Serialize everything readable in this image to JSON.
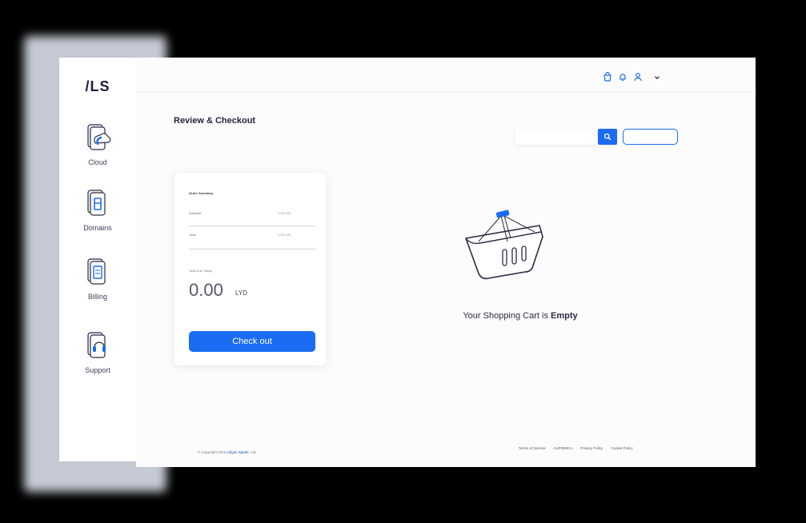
{
  "app": {
    "logo": "/LS"
  },
  "sidebar": {
    "items": [
      {
        "label": "Cloud",
        "icon": "cloud-icon"
      },
      {
        "label": "Domains",
        "icon": "domains-icon"
      },
      {
        "label": "Billing",
        "icon": "billing-icon"
      },
      {
        "label": "Support",
        "icon": "support-icon"
      }
    ]
  },
  "header": {
    "icons": [
      "cart-icon",
      "bell-icon",
      "user-icon",
      "chevron-down-icon"
    ]
  },
  "page": {
    "title": "Review & Checkout"
  },
  "search": {
    "placeholder": "",
    "button_icon": "search-icon"
  },
  "order": {
    "summary_title": "Order Summary",
    "rows": [
      {
        "label": "Subtotal",
        "value": "0.00 LYD"
      },
      {
        "label": "Total",
        "value": "0.00 LYD"
      }
    ],
    "total_due_label": "Total Due Today",
    "amount": "0.00",
    "currency": "LYD",
    "checkout_label": "Check out"
  },
  "cart": {
    "empty_prefix": "Your Shopping Cart is ",
    "empty_strong": "Empty"
  },
  "footer": {
    "copyright_prefix": "© Copyright 2022",
    "company": "Libyan Spider",
    "copyright_suffix": ", Ltd.",
    "links": [
      "Terms of Service",
      "AUP/DMCA",
      "Privacy Policy",
      "Cookie Policy"
    ]
  },
  "colors": {
    "accent": "#1b6cf2",
    "text": "#2b2d42"
  }
}
